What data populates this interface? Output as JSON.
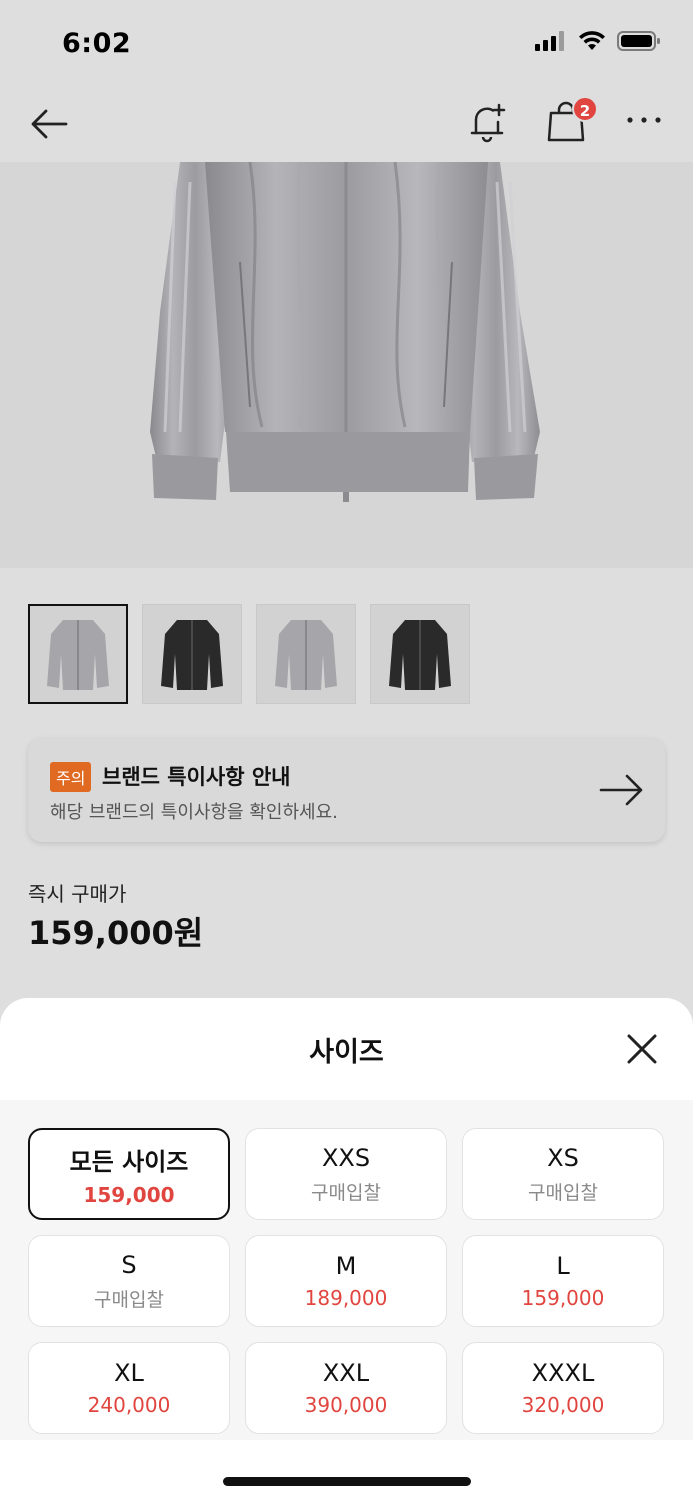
{
  "status_bar": {
    "time": "6:02"
  },
  "nav": {
    "cart_count": "2"
  },
  "notice": {
    "tag": "주의",
    "title": "브랜드 특이사항 안내",
    "subtitle": "해당 브랜드의 특이사항을 확인하세요."
  },
  "price": {
    "label": "즉시 구매가",
    "value": "159,000원"
  },
  "sheet": {
    "title": "사이즈",
    "sizes": [
      {
        "name": "모든 사이즈",
        "price": "159,000"
      },
      {
        "name": "XXS",
        "price": "구매입찰"
      },
      {
        "name": "XS",
        "price": "구매입찰"
      },
      {
        "name": "S",
        "price": "구매입찰"
      },
      {
        "name": "M",
        "price": "189,000"
      },
      {
        "name": "L",
        "price": "159,000"
      },
      {
        "name": "XL",
        "price": "240,000"
      },
      {
        "name": "XXL",
        "price": "390,000"
      },
      {
        "name": "XXXL",
        "price": "320,000"
      }
    ]
  },
  "colors": {
    "accent": "#e0463f",
    "tag": "#e06a22"
  }
}
